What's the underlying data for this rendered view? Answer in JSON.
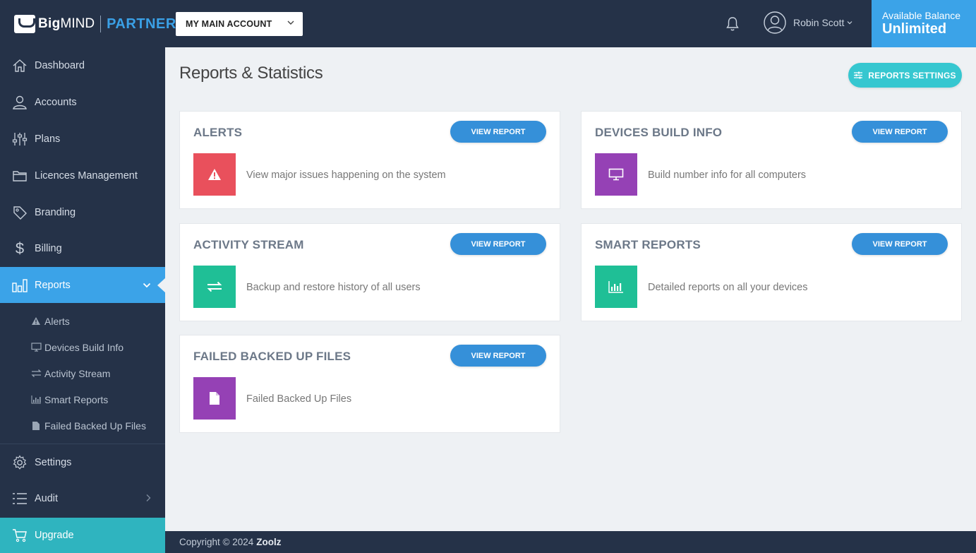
{
  "brand": {
    "big": "Big",
    "mind": "MIND",
    "partner": "PARTNER"
  },
  "header": {
    "account_select": "MY MAIN ACCOUNT",
    "user_name": "Robin Scott",
    "balance_label": "Available Balance",
    "balance_value": "Unlimited"
  },
  "sidebar": {
    "items": [
      {
        "label": "Dashboard",
        "icon": "home-icon"
      },
      {
        "label": "Accounts",
        "icon": "user-icon"
      },
      {
        "label": "Plans",
        "icon": "sliders-icon"
      },
      {
        "label": "Licences Management",
        "icon": "folder-icon"
      },
      {
        "label": "Branding",
        "icon": "tag-icon"
      },
      {
        "label": "Billing",
        "icon": "dollar-icon"
      },
      {
        "label": "Reports",
        "icon": "bar-chart-icon"
      },
      {
        "label": "Settings",
        "icon": "gear-icon"
      },
      {
        "label": "Audit",
        "icon": "list-icon"
      },
      {
        "label": "Upgrade",
        "icon": "cart-icon"
      }
    ],
    "reports_sub": [
      {
        "label": "Alerts",
        "icon": "warning-icon"
      },
      {
        "label": "Devices Build Info",
        "icon": "monitor-icon"
      },
      {
        "label": "Activity Stream",
        "icon": "exchange-icon"
      },
      {
        "label": "Smart Reports",
        "icon": "bar-chart-icon"
      },
      {
        "label": "Failed Backed Up Files",
        "icon": "file-icon"
      }
    ]
  },
  "main": {
    "title": "Reports & Statistics",
    "settings_button": "REPORTS SETTINGS",
    "view_report_label": "VIEW REPORT",
    "cards": [
      {
        "title": "ALERTS",
        "description": "View major issues happening on the system",
        "icon": "warning-icon",
        "color": "#e9505c"
      },
      {
        "title": "DEVICES BUILD INFO",
        "description": "Build number info for all computers",
        "icon": "monitor-icon",
        "color": "#9541b5"
      },
      {
        "title": "ACTIVITY STREAM",
        "description": "Backup and restore history of all users",
        "icon": "exchange-icon",
        "color": "#1fbf96"
      },
      {
        "title": "SMART REPORTS",
        "description": "Detailed reports on all your devices",
        "icon": "bar-chart-icon",
        "color": "#1fbf96"
      },
      {
        "title": "FAILED BACKED UP FILES",
        "description": "Failed Backed Up Files",
        "icon": "file-icon",
        "color": "#9541b5"
      }
    ]
  },
  "footer": {
    "copyright": "Copyright © 2024",
    "company": "Zoolz"
  },
  "colors": {
    "nav_bg": "#253248",
    "accent": "#3ba3e8",
    "teal": "#36c7d0",
    "upgrade": "#2fb4bf"
  }
}
